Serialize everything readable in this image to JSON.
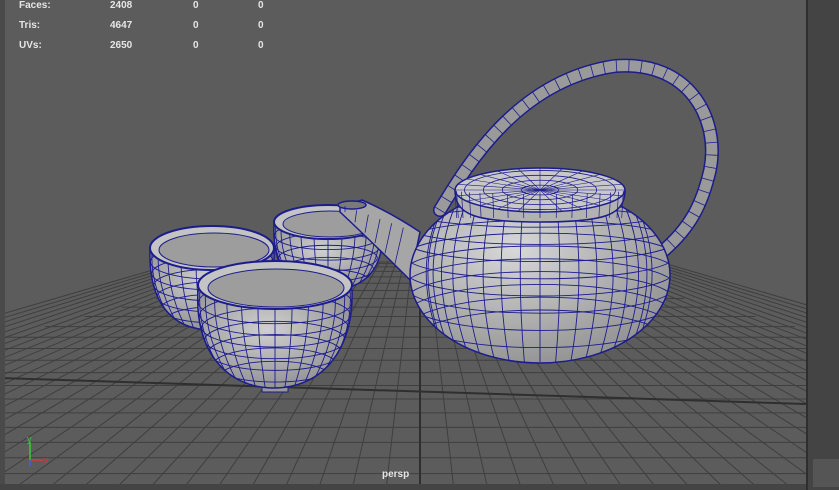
{
  "hud": {
    "rows": [
      {
        "label": "Faces:",
        "v1": "2408",
        "v2": "0",
        "v3": "0"
      },
      {
        "label": "Tris:",
        "v1": "4647",
        "v2": "0",
        "v3": "0"
      },
      {
        "label": "UVs:",
        "v1": "2650",
        "v2": "0",
        "v3": "0"
      }
    ]
  },
  "viewport": {
    "camera": "persp"
  },
  "axis": {
    "y": "y",
    "x": "x"
  },
  "colors": {
    "viewport_bg": "#5c5c5c",
    "grid": "#3f3f3f",
    "grid_center": "#2f2f2f",
    "wireframe": "#1c1c8c",
    "mesh_fill": "#b4b4b4",
    "axis_x": "#d23c3c",
    "axis_y": "#3cc83c",
    "axis_z": "#3c64dc"
  }
}
